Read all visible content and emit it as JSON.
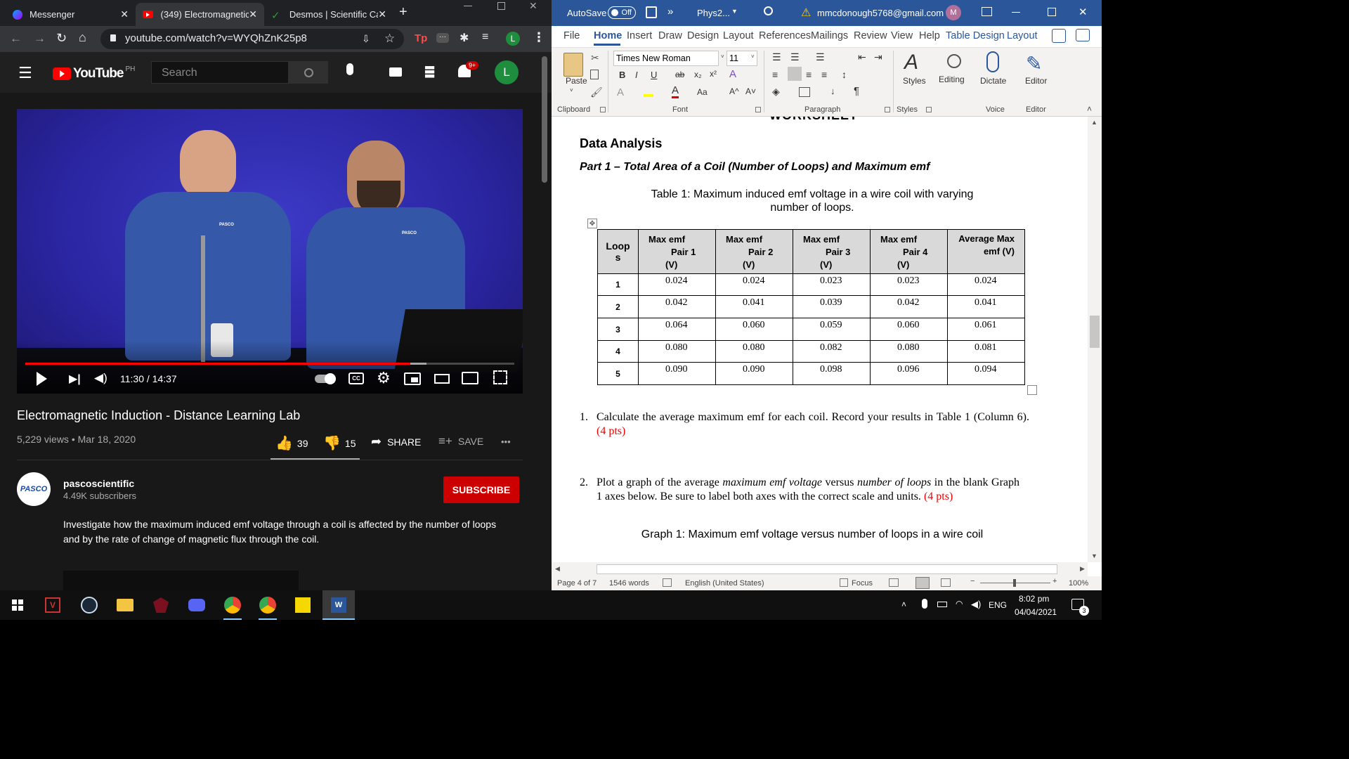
{
  "chrome": {
    "tabs": [
      {
        "label": "Messenger",
        "close": "✕"
      },
      {
        "label": "(349) Electromagnetic",
        "close": "✕"
      },
      {
        "label": "Desmos | Scientific Ca",
        "close": "✕"
      }
    ],
    "new_tab": "+",
    "url": "youtube.com/watch?v=WYQhZnK25p8",
    "profile_initial": "L",
    "ext_tp": "Tp"
  },
  "youtube": {
    "logo": "YouTube",
    "region": "PH",
    "search_placeholder": "Search",
    "notif_count": "9+",
    "avatar": "L",
    "video": {
      "time_current": "11:30",
      "time_total": "14:37",
      "time_sep": " / ",
      "progress": 0.787,
      "buffered": 0.82,
      "sign_left": "PASCO",
      "sign_right": "PASCO"
    },
    "title": "Electromagnetic Induction - Distance Learning Lab",
    "views": "5,229 views",
    "dot": "•",
    "date": "Mar 18, 2020",
    "likes": "39",
    "dislikes": "15",
    "share": "SHARE",
    "save": "SAVE",
    "more": "•••",
    "channel": "pascoscientific",
    "channel_logo": "PASCO",
    "subscribers": "4.49K subscribers",
    "subscribe": "SUBSCRIBE",
    "description": "Investigate how the maximum induced emf voltage through a coil  is affected by the number of loops and by the rate of change of magnetic flux through the coil."
  },
  "word": {
    "autosave_label": "AutoSave",
    "autosave_state": "Off",
    "more": "»",
    "doc_name": "Phys2...",
    "account": "mmcdonough5768@gmail.com",
    "account_initial": "M",
    "menu_tabs": [
      "File",
      "Home",
      "Insert",
      "Draw",
      "Design",
      "Layout",
      "References",
      "Mailings",
      "Review",
      "View",
      "Help",
      "Table Design",
      "Layout"
    ],
    "font_name": "Times New Roman",
    "font_size": "11",
    "groups": {
      "clipboard": "Clipboard",
      "font": "Font",
      "paragraph": "Paragraph",
      "styles": "Styles",
      "voice": "Voice",
      "editor": "Editor"
    },
    "big_buttons": {
      "paste": "Paste",
      "styles": "Styles",
      "editing": "Editing",
      "dictate": "Dictate",
      "editor": "Editor"
    },
    "fmt": {
      "bold": "B",
      "italic": "I",
      "underline": "U",
      "strike": "ab",
      "sub": "x₂",
      "sup": "x²",
      "aa": "Aa",
      "grow": "A^",
      "shrink": "A˅",
      "pilcrow": "¶"
    },
    "cut_heading": "WORKSHEET",
    "section_title": "Data Analysis",
    "part_title": "Part 1 – Total Area of a Coil (Number of Loops) and Maximum emf",
    "table_caption": "Table 1: Maximum induced emf voltage in a wire coil with varying number of loops.",
    "table_headers": [
      {
        "l1": "Loop",
        "l2": "s",
        "l3": ""
      },
      {
        "l1": "Max emf",
        "l2": "Pair 1",
        "l3": "(V)"
      },
      {
        "l1": "Max emf",
        "l2": "Pair 2",
        "l3": "(V)"
      },
      {
        "l1": "Max emf",
        "l2": "Pair 3",
        "l3": "(V)"
      },
      {
        "l1": "Max emf",
        "l2": "Pair 4",
        "l3": "(V)"
      },
      {
        "l1": "Average Max",
        "l2": "emf (V)",
        "l3": ""
      }
    ],
    "table_rows": [
      [
        "1",
        "0.024",
        "0.024",
        "0.023",
        "0.023",
        "0.024"
      ],
      [
        "2",
        "0.042",
        "0.041",
        "0.039",
        "0.042",
        "0.041"
      ],
      [
        "3",
        "0.064",
        "0.060",
        "0.059",
        "0.060",
        "0.061"
      ],
      [
        "4",
        "0.080",
        "0.080",
        "0.082",
        "0.080",
        "0.081"
      ],
      [
        "5",
        "0.090",
        "0.090",
        "0.098",
        "0.096",
        "0.094"
      ]
    ],
    "q1_num": "1.",
    "q1_text": "Calculate the average maximum emf for each coil. Record your results in Table 1 (Column 6).",
    "q1_pts": "(4 pts)",
    "q2_num": "2.",
    "q2_a": "Plot a graph of the average ",
    "q2_b": "maximum emf voltage",
    "q2_c": " versus ",
    "q2_d": "number of loops",
    "q2_e": " in the blank Graph 1 axes below. Be sure to label both axes with the correct scale and units.",
    "q2_pts": "(4 pts)",
    "graph_caption": "Graph 1: Maximum emf voltage versus number of loops in a wire coil",
    "status": {
      "page": "Page 4 of 7",
      "words": "1546 words",
      "lang": "English (United States)",
      "focus": "Focus",
      "zoom": "100%"
    }
  },
  "taskbar": {
    "time": "8:02 pm",
    "date": "04/04/2021",
    "lang": "ENG",
    "notif_count": "3"
  },
  "colors": {
    "accent_red": "#cc0000",
    "word_blue": "#2b579a",
    "yt_red": "#ff0000"
  }
}
